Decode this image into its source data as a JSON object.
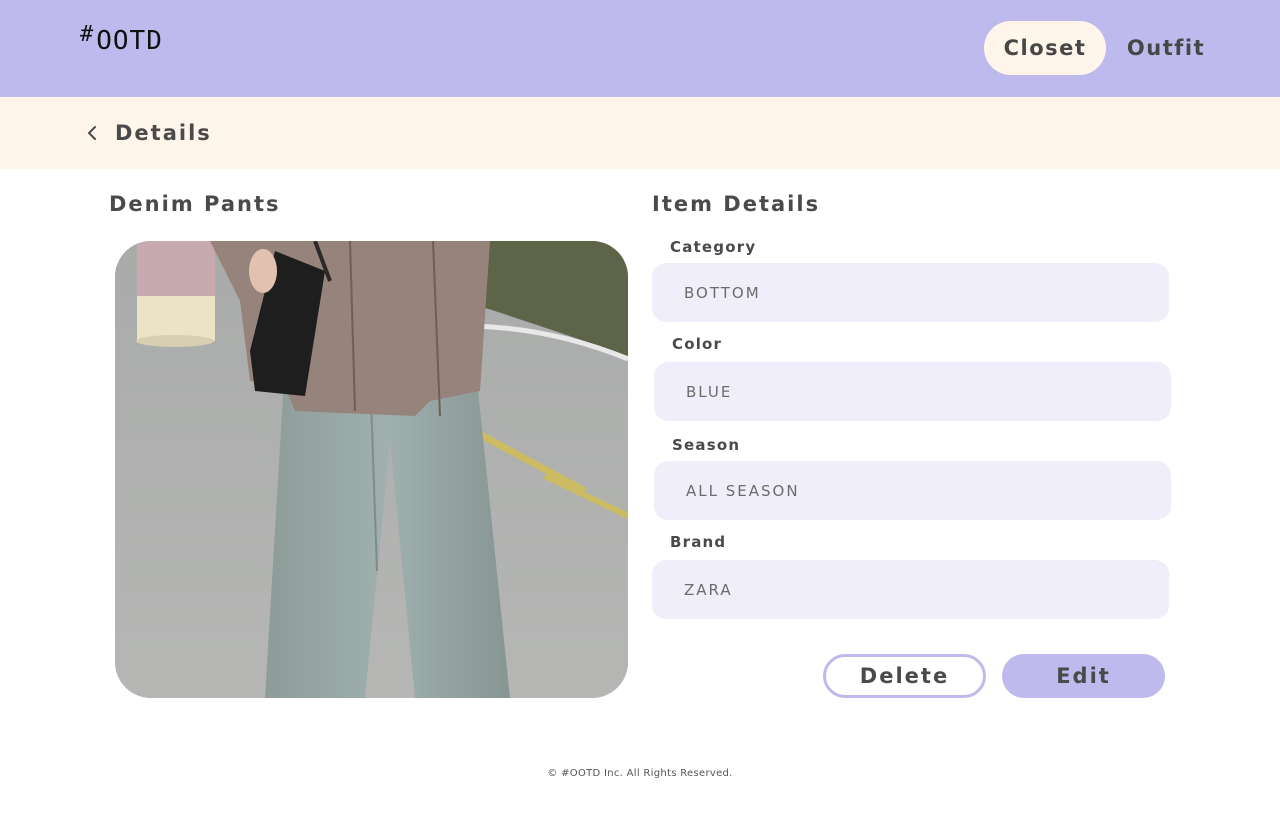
{
  "header": {
    "logo_hash": "#",
    "logo_text": "OOTD",
    "nav": {
      "closet": "Closet",
      "outfit": "Outfit"
    }
  },
  "subheader": {
    "back_icon": "chevron-left-icon",
    "title": "Details"
  },
  "item": {
    "name": "Denim Pants",
    "photo_subject": "person-wearing-wide-leg-jeans-photo"
  },
  "details": {
    "title": "Item Details",
    "fields": [
      {
        "label": "Category",
        "value": "BOTTOM"
      },
      {
        "label": "Color",
        "value": "BLUE"
      },
      {
        "label": "Season",
        "value": "ALL SEASON"
      },
      {
        "label": "Brand",
        "value": "ZARA"
      }
    ]
  },
  "actions": {
    "delete": "Delete",
    "edit": "Edit"
  },
  "footer": {
    "copyright": "© #OOTD Inc. All Rights Reserved."
  },
  "colors": {
    "accent": "#bfbaee",
    "cream": "#fff5ea",
    "field_bg": "#f0eefa",
    "text": "#4a4a4a"
  }
}
